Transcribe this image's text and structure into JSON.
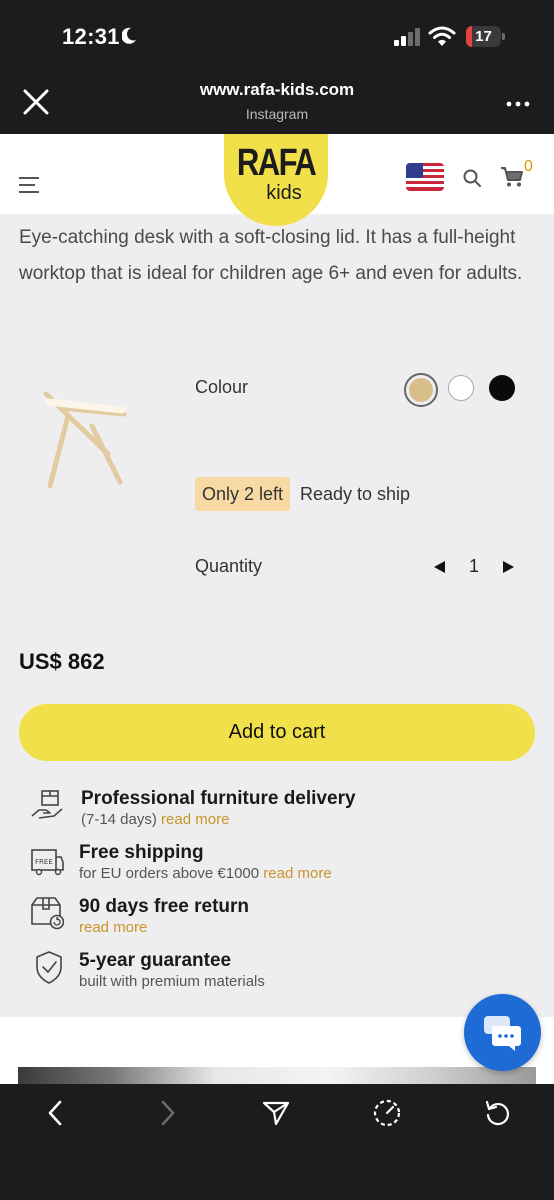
{
  "status_bar": {
    "time": "12:31",
    "battery": "17",
    "battery_level_percent": 17,
    "icons": [
      "moon-icon",
      "signal-icon",
      "wifi-icon",
      "battery-icon"
    ]
  },
  "browser": {
    "url": "www.rafa-kids.com",
    "source": "Instagram",
    "icons": [
      "close-icon",
      "more-icon"
    ]
  },
  "header": {
    "logo_top": "RAFA",
    "logo_bottom": "kids",
    "cart_count": "0",
    "icons": [
      "menu-icon",
      "us-flag-icon",
      "search-icon",
      "cart-icon"
    ],
    "brand_color": "#f1e04a"
  },
  "product": {
    "description": "Eye-catching desk with a soft-closing lid. It has a full-height worktop that is ideal for children age 6+ and even for adults.",
    "colour_label": "Colour",
    "colours": [
      {
        "name": "natural",
        "hex": "#d8bf8a",
        "selected": true
      },
      {
        "name": "white",
        "hex": "#ffffff",
        "selected": false
      },
      {
        "name": "black",
        "hex": "#0a0a0a",
        "selected": false
      }
    ],
    "stock_badge": "Only 2 left",
    "ship_status": "Ready to ship",
    "quantity_label": "Quantity",
    "quantity": "1",
    "price": "US$ 862",
    "add_to_cart": "Add to cart"
  },
  "features": [
    {
      "icon": "delivery-icon",
      "title": "Professional furniture delivery",
      "sub": "(7-14 days)",
      "link": "read more"
    },
    {
      "icon": "free-shipping-icon",
      "title": "Free shipping",
      "sub": "for EU orders above €1000",
      "link": "read more"
    },
    {
      "icon": "return-icon",
      "title": "90 days free return",
      "sub": "",
      "link": "read more"
    },
    {
      "icon": "shield-icon",
      "title": "5-year guarantee",
      "sub": "built with premium materials",
      "link": ""
    }
  ],
  "chat": {
    "icon": "chat-icon",
    "color": "#1e6bd6"
  },
  "nav": {
    "icons": [
      "back-icon",
      "forward-icon",
      "share-icon",
      "speed-icon",
      "reload-icon"
    ]
  }
}
